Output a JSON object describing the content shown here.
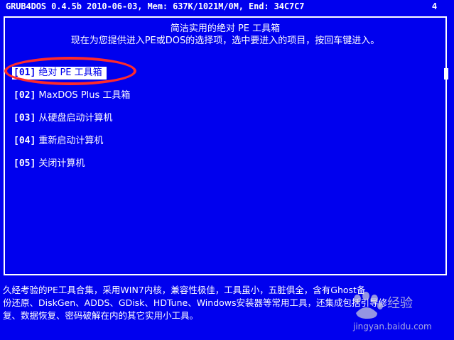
{
  "status_bar": {
    "text": "GRUB4DOS 0.4.5b 2010-06-03, Mem: 637K/1021M/0M, End: 34C7C7",
    "page": "4"
  },
  "menu": {
    "title": "简洁实用的绝对 PE 工具箱",
    "subtitle": "现在为您提供进入PE或DOS的选择项，选中要进入的项目，按回车键进入。",
    "selected_index": 0,
    "items": [
      {
        "num": "[01]",
        "label": "绝对 PE 工具箱"
      },
      {
        "num": "[02]",
        "label": "MaxDOS Plus 工具箱"
      },
      {
        "num": "[03]",
        "label": "从硬盘启动计算机"
      },
      {
        "num": "[04]",
        "label": "重新启动计算机"
      },
      {
        "num": "[05]",
        "label": "关闭计算机"
      }
    ]
  },
  "description": {
    "line1": "久经考验的PE工具合集，采用WIN7内核，兼容性极佳，工具虽小，五脏俱全，含有Ghost备",
    "line2": "份还原、DiskGen、ADDS、GDisk、HDTune、Windows安装器等常用工具，还集成包括引导修",
    "line3": "复、数据恢复、密码破解在内的其它实用小工具。"
  },
  "watermark": {
    "brand_cn": "经验",
    "url": "jingyan.baidu.com"
  },
  "colors": {
    "background": "#0000ee",
    "text": "#ffffff",
    "highlight_ring": "#ff2a2a"
  }
}
